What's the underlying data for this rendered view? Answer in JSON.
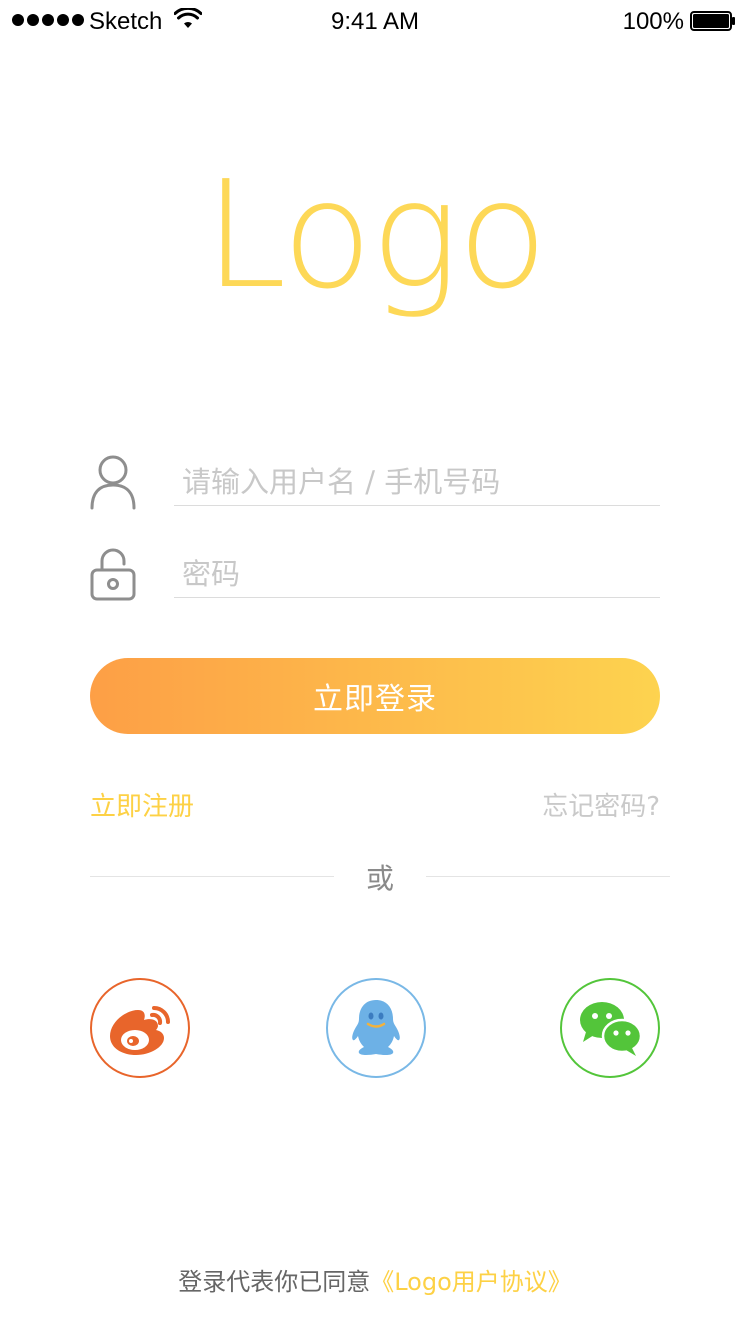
{
  "status_bar": {
    "carrier": "Sketch",
    "time": "9:41 AM",
    "battery": "100%"
  },
  "logo": {
    "text": "Logo",
    "color": "#fdd857"
  },
  "form": {
    "username_placeholder": "请输入用户名 / 手机号码",
    "password_placeholder": "密码",
    "username_icon": "user-icon",
    "password_icon": "lock-icon"
  },
  "login_button": {
    "label": "立即登录",
    "gradient": [
      "#fd9f46",
      "#fdd34f"
    ]
  },
  "links": {
    "register": "立即注册",
    "forgot": "忘记密码?"
  },
  "divider": {
    "text": "或"
  },
  "social": [
    {
      "name": "weibo",
      "icon": "weibo-icon",
      "color": "#e8652b"
    },
    {
      "name": "qq",
      "icon": "qq-icon",
      "color": "#79b8e6"
    },
    {
      "name": "wechat",
      "icon": "wechat-icon",
      "color": "#53c53a"
    }
  ],
  "footer": {
    "prefix": "登录代表你已同意",
    "agreement": "《Logo用户协议》"
  }
}
